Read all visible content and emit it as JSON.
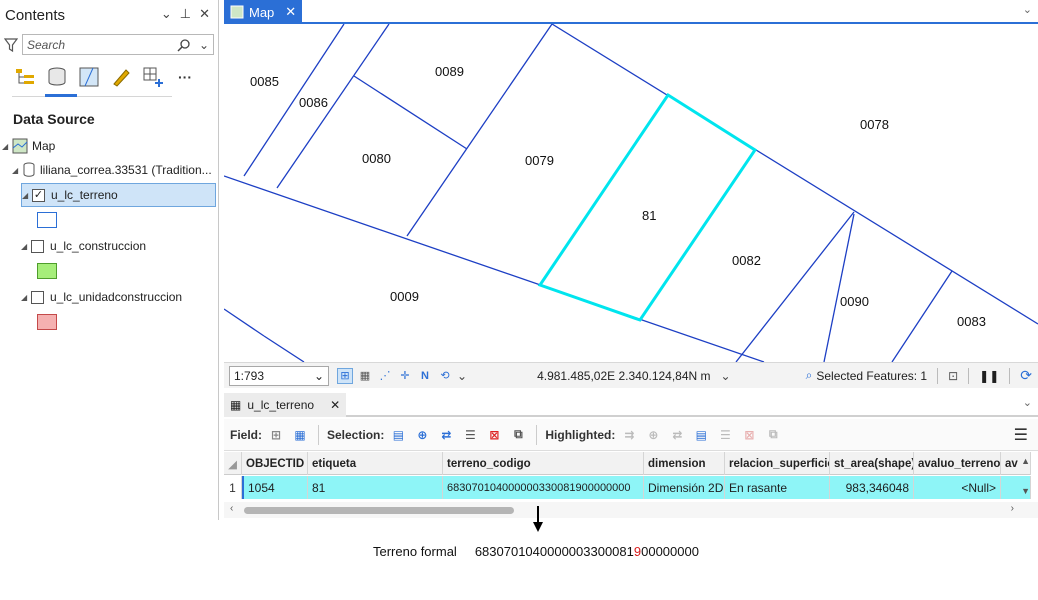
{
  "contents": {
    "title": "Contents",
    "search_placeholder": "Search",
    "section_title": "Data Source",
    "tree": {
      "map": "Map",
      "database": "liliana_correa.33531 (Tradition...",
      "layers": [
        {
          "name": "u_lc_terreno",
          "checked": true,
          "swatch_fill": "#ffffff",
          "swatch_border": "#2b6fd6"
        },
        {
          "name": "u_lc_construccion",
          "checked": false,
          "swatch_fill": "#a6ee7a",
          "swatch_border": "#4f9d2c"
        },
        {
          "name": "u_lc_unidadconstruccion",
          "checked": false,
          "swatch_fill": "#f5b1b1",
          "swatch_border": "#c44a4a"
        }
      ]
    }
  },
  "map_tab": {
    "label": "Map"
  },
  "map": {
    "line_color": "#1d3fc4",
    "selected_color": "#00e5ee",
    "parcels": [
      "0085",
      "0086",
      "0089",
      "0080",
      "0079",
      "0078",
      "81",
      "0082",
      "0009",
      "0090",
      "0083"
    ]
  },
  "map_status": {
    "scale": "1:793",
    "coordinates": "4.981.485,02E 2.340.124,84N m",
    "selected_features": "Selected Features: 1"
  },
  "table_tab": {
    "label": "u_lc_terreno"
  },
  "table_toolbar": {
    "field": "Field:",
    "selection": "Selection:",
    "highlighted": "Highlighted:"
  },
  "table": {
    "columns": [
      "OBJECTID *",
      "etiqueta",
      "terreno_codigo",
      "dimension",
      "relacion_superficie",
      "st_area(shape)",
      "avaluo_terreno",
      "av"
    ],
    "rows": [
      {
        "num": "1",
        "cells": [
          "1054",
          "81",
          "683070104000000330081900000000",
          "Dimensión 2D",
          "En rasante",
          "983,346048",
          "<Null>",
          ""
        ]
      }
    ],
    "row_color": "#8ef5f7"
  },
  "annotation": {
    "label": "Terreno formal",
    "code_prefix": "6830701040000003300081",
    "code_highlight": "9",
    "code_suffix": "00000000"
  }
}
